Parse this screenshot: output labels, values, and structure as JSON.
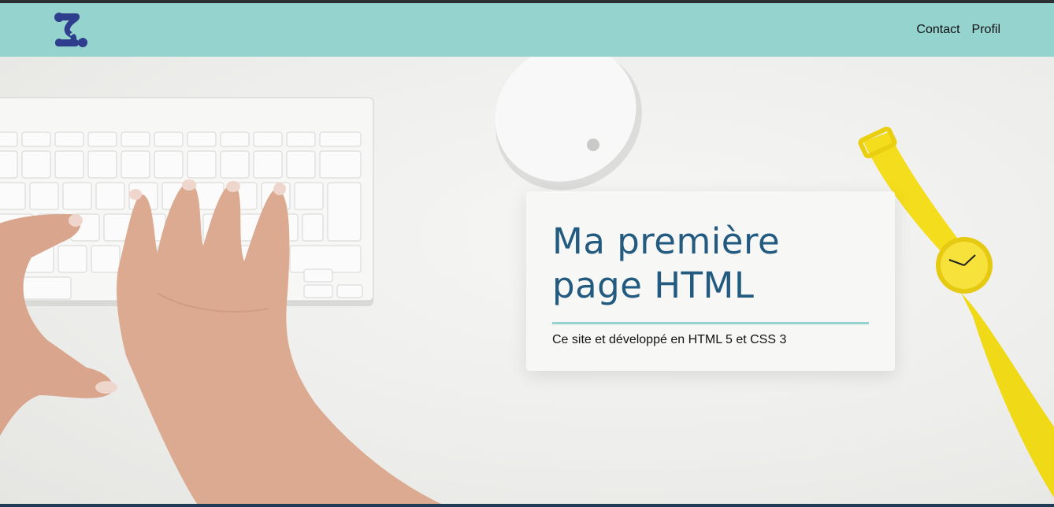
{
  "header": {
    "logo_icon": "logo-icon",
    "nav": [
      {
        "label": "Contact"
      },
      {
        "label": "Profil"
      }
    ]
  },
  "hero": {
    "title": "Ma première page HTML",
    "subtitle": "Ce site et développé en HTML 5 et CSS 3",
    "image_subject": "hands typing on keyboard, mouse, yellow wristwatch"
  },
  "colors": {
    "navbar": "#95d3cf",
    "title": "#225a80",
    "accent_rule": "#95d3cf",
    "logo": "#2e3e8c"
  }
}
